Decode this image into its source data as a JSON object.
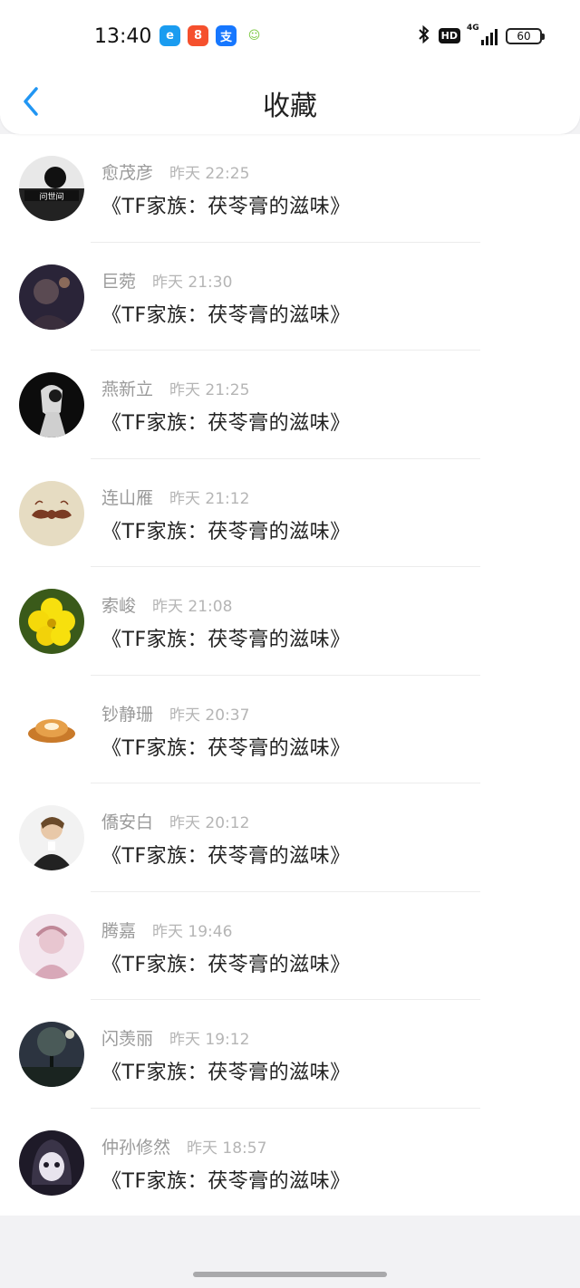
{
  "status_bar": {
    "time": "13:40",
    "apps": [
      {
        "icon": "ele-me-app-icon",
        "glyph": "e",
        "color": "#1a9cf0"
      },
      {
        "icon": "kuaishou-app-icon",
        "glyph": "8",
        "color": "#f5502d"
      },
      {
        "icon": "alipay-app-icon",
        "glyph": "支",
        "color": "#1677ff"
      },
      {
        "icon": "wechat-mini-icon",
        "glyph": "☺",
        "color": "#7cc842"
      }
    ],
    "network_label": "4G",
    "hd_label": "HD",
    "battery_level": "60"
  },
  "nav": {
    "back_icon": "chevron-left-icon",
    "title": "收藏"
  },
  "favorites": [
    {
      "name": "愈茂彦",
      "time": "昨天 22:25",
      "title": "《TF家族：茯苓膏的滋味》",
      "avatar": "bw-photo"
    },
    {
      "name": "巨菀",
      "time": "昨天 21:30",
      "title": "《TF家族：茯苓膏的滋味》",
      "avatar": "dark-night"
    },
    {
      "name": "燕新立",
      "time": "昨天 21:25",
      "title": "《TF家族：茯苓膏的滋味》",
      "avatar": "bw-dark"
    },
    {
      "name": "连山雁",
      "time": "昨天 21:12",
      "title": "《TF家族：茯苓膏的滋味》",
      "avatar": "mustache"
    },
    {
      "name": "索峻",
      "time": "昨天 21:08",
      "title": "《TF家族：茯苓膏的滋味》",
      "avatar": "yellow-flower"
    },
    {
      "name": "钞静珊",
      "time": "昨天 20:37",
      "title": "《TF家族：茯苓膏的滋味》",
      "avatar": "food-bowl"
    },
    {
      "name": "僑安白",
      "time": "昨天 20:12",
      "title": "《TF家族：茯苓膏的滋味》",
      "avatar": "portrait"
    },
    {
      "name": "腾嘉",
      "time": "昨天 19:46",
      "title": "《TF家族：茯苓膏的滋味》",
      "avatar": "pink-art"
    },
    {
      "name": "闪羡丽",
      "time": "昨天 19:12",
      "title": "《TF家族：茯苓膏的滋味》",
      "avatar": "tree-night"
    },
    {
      "name": "仲孙修然",
      "time": "昨天 18:57",
      "title": "《TF家族：茯苓膏的滋味》",
      "avatar": "masked"
    }
  ],
  "colors": {
    "accent": "#2196f3",
    "name_text": "#9a9a9a",
    "time_text": "#b5b5b5",
    "title_text": "#222222"
  }
}
